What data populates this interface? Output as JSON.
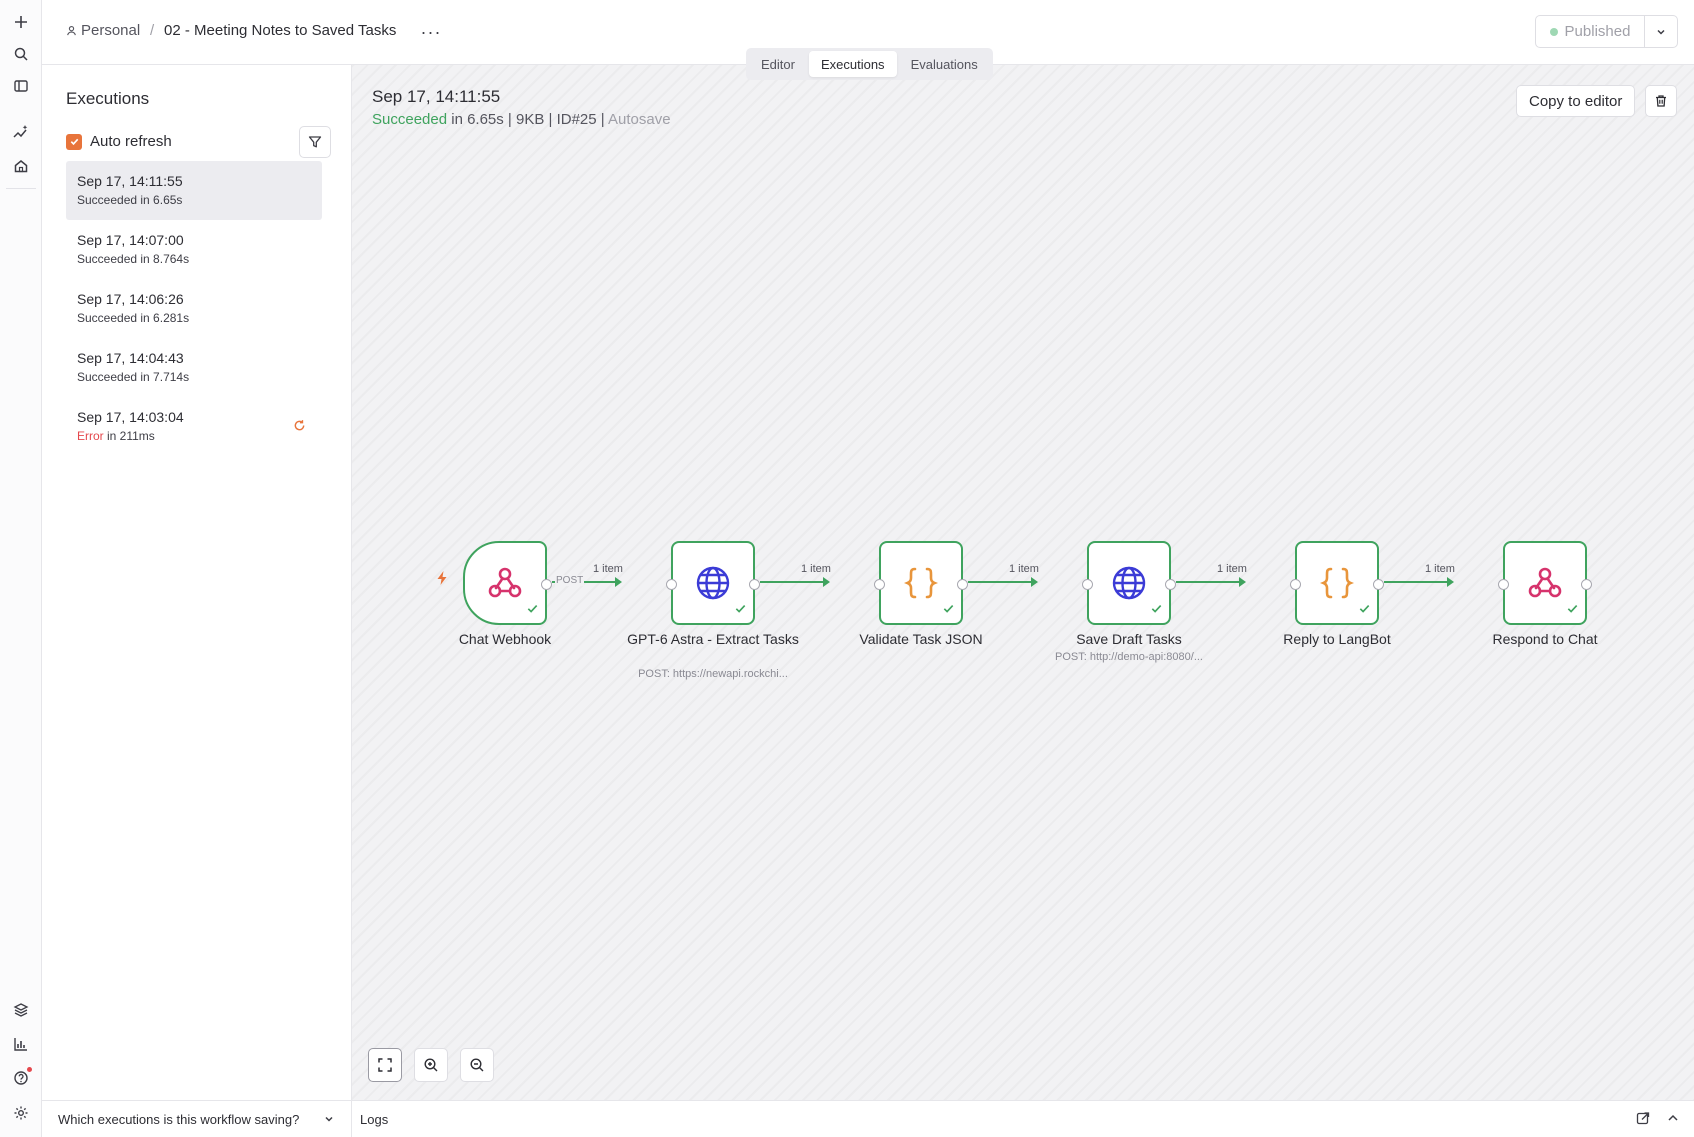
{
  "header": {
    "project": "Personal",
    "separator": "/",
    "workflow_title": "02 - Meeting Notes to Saved Tasks",
    "more": "···",
    "publish_label": "Published"
  },
  "tabs": [
    {
      "label": "Editor",
      "active": false
    },
    {
      "label": "Executions",
      "active": true
    },
    {
      "label": "Evaluations",
      "active": false
    }
  ],
  "executions": {
    "heading": "Executions",
    "auto_refresh_label": "Auto refresh",
    "auto_refresh_checked": true,
    "items": [
      {
        "time": "Sep 17, 14:11:55",
        "status_word": "Succeeded",
        "status_rest": " in 6.65s",
        "selected": true
      },
      {
        "time": "Sep 17, 14:07:00",
        "status_word": "Succeeded",
        "status_rest": " in 8.764s",
        "selected": false
      },
      {
        "time": "Sep 17, 14:06:26",
        "status_word": "Succeeded",
        "status_rest": " in 6.281s",
        "selected": false
      },
      {
        "time": "Sep 17, 14:04:43",
        "status_word": "Succeeded",
        "status_rest": " in 7.714s",
        "selected": false
      },
      {
        "time": "Sep 17, 14:03:04",
        "status_word": "Error",
        "status_rest": " in 211ms",
        "selected": false
      }
    ],
    "footer_question": "Which executions is this workflow saving?"
  },
  "detail": {
    "title": "Sep 17, 14:11:55",
    "status": "Succeeded",
    "meta": " in 6.65s | 9KB | ID#25 | ",
    "mode": "Autosave",
    "copy_label": "Copy to editor"
  },
  "workflow": {
    "nodes": [
      {
        "name": "Chat Webhook",
        "icon": "webhook-icon",
        "subtitle": ""
      },
      {
        "name": "GPT-6 Astra - Extract Tasks",
        "icon": "globe-icon",
        "subtitle": "POST: https://newapi.rockchi..."
      },
      {
        "name": "Validate Task JSON",
        "icon": "braces-icon",
        "subtitle": ""
      },
      {
        "name": "Save Draft Tasks",
        "icon": "globe-icon",
        "subtitle": "POST: http://demo-api:8080/..."
      },
      {
        "name": "Reply to LangBot",
        "icon": "braces-icon",
        "subtitle": ""
      },
      {
        "name": "Respond to Chat",
        "icon": "webhook-icon",
        "subtitle": ""
      }
    ],
    "edges": [
      "1 item",
      "1 item",
      "1 item",
      "1 item",
      "1 item"
    ],
    "trigger_method": "POST"
  },
  "logs": {
    "label": "Logs"
  },
  "colors": {
    "accent": "#e8743b",
    "success": "#3fa35e",
    "error": "#e5484d",
    "webhook": "#d6336c",
    "globe": "#3b3bd6",
    "braces": "#e8953b"
  }
}
